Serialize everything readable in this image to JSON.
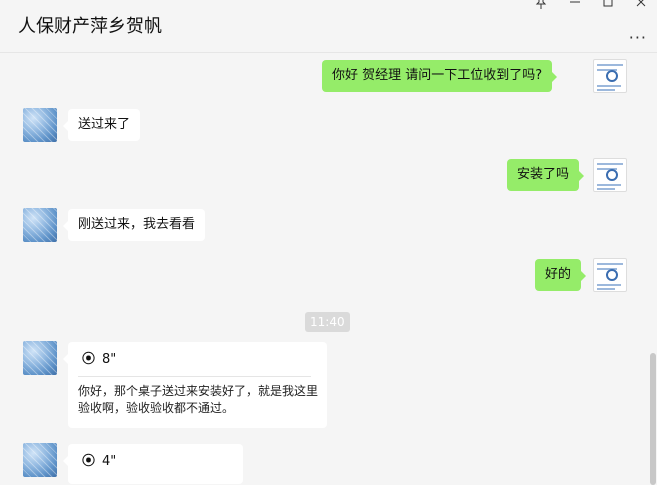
{
  "header": {
    "title": "人保财产萍乡贺帆",
    "pin_icon": "pin-icon",
    "minimize_icon": "minimize-icon",
    "maximize_icon": "maximize-icon",
    "close_icon": "close-icon",
    "more_icon": "more-icon",
    "more_glyph": "···"
  },
  "messages": [
    {
      "side": "right",
      "text": "你好  贺经理  请问一下工位收到了吗?"
    },
    {
      "side": "left",
      "text": "送过来了"
    },
    {
      "side": "right",
      "text": "安装了吗"
    },
    {
      "side": "left",
      "text": "刚送过来，我去看看"
    },
    {
      "side": "right",
      "text": "好的"
    }
  ],
  "timestamp": "11:40",
  "voice_messages": [
    {
      "duration": "8\"",
      "transcript": "你好，那个桌子送过来安装好了，就是我这里验收啊，验收验收都不通过。"
    },
    {
      "duration": "4\"",
      "transcript": ""
    }
  ],
  "colors": {
    "outgoing_bubble": "#95ec69",
    "incoming_bubble": "#ffffff",
    "background": "#f5f5f5"
  }
}
